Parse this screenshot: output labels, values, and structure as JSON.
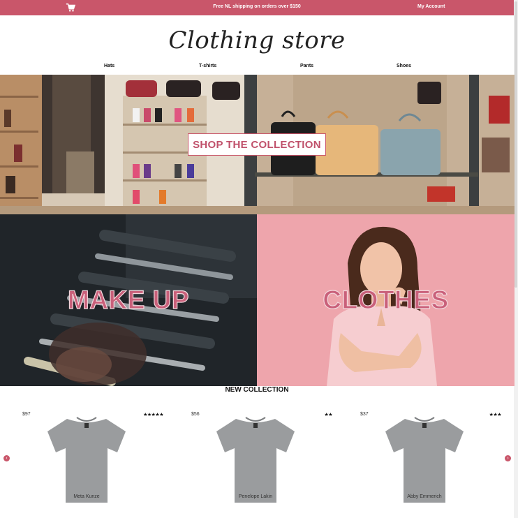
{
  "topbar": {
    "cart_icon": "shopping-cart-icon",
    "promo": "Free NL shipping on orders over $150",
    "account": "My Account",
    "color": "#c9566a"
  },
  "header": {
    "logo": "Clothing store",
    "nav": [
      "Hats",
      "T-shirts",
      "Pants",
      "Shoes"
    ]
  },
  "hero": {
    "cta": "SHOP THE COLLECTION"
  },
  "tiles": {
    "makeup": "MAKE UP",
    "clothes": "CLOTHES"
  },
  "collection": {
    "title": "NEW COLLECTION",
    "products": [
      {
        "price": "$97",
        "stars": "★★★★★",
        "rating": 5,
        "name": "Meta Kunze"
      },
      {
        "price": "$56",
        "stars": "★★",
        "rating": 2,
        "name": "Penelope Lakin"
      },
      {
        "price": "$37",
        "stars": "★★★",
        "rating": 3,
        "name": "Abby Emmerich"
      }
    ],
    "prev_icon": "chevron-left-icon",
    "next_icon": "chevron-right-icon"
  }
}
